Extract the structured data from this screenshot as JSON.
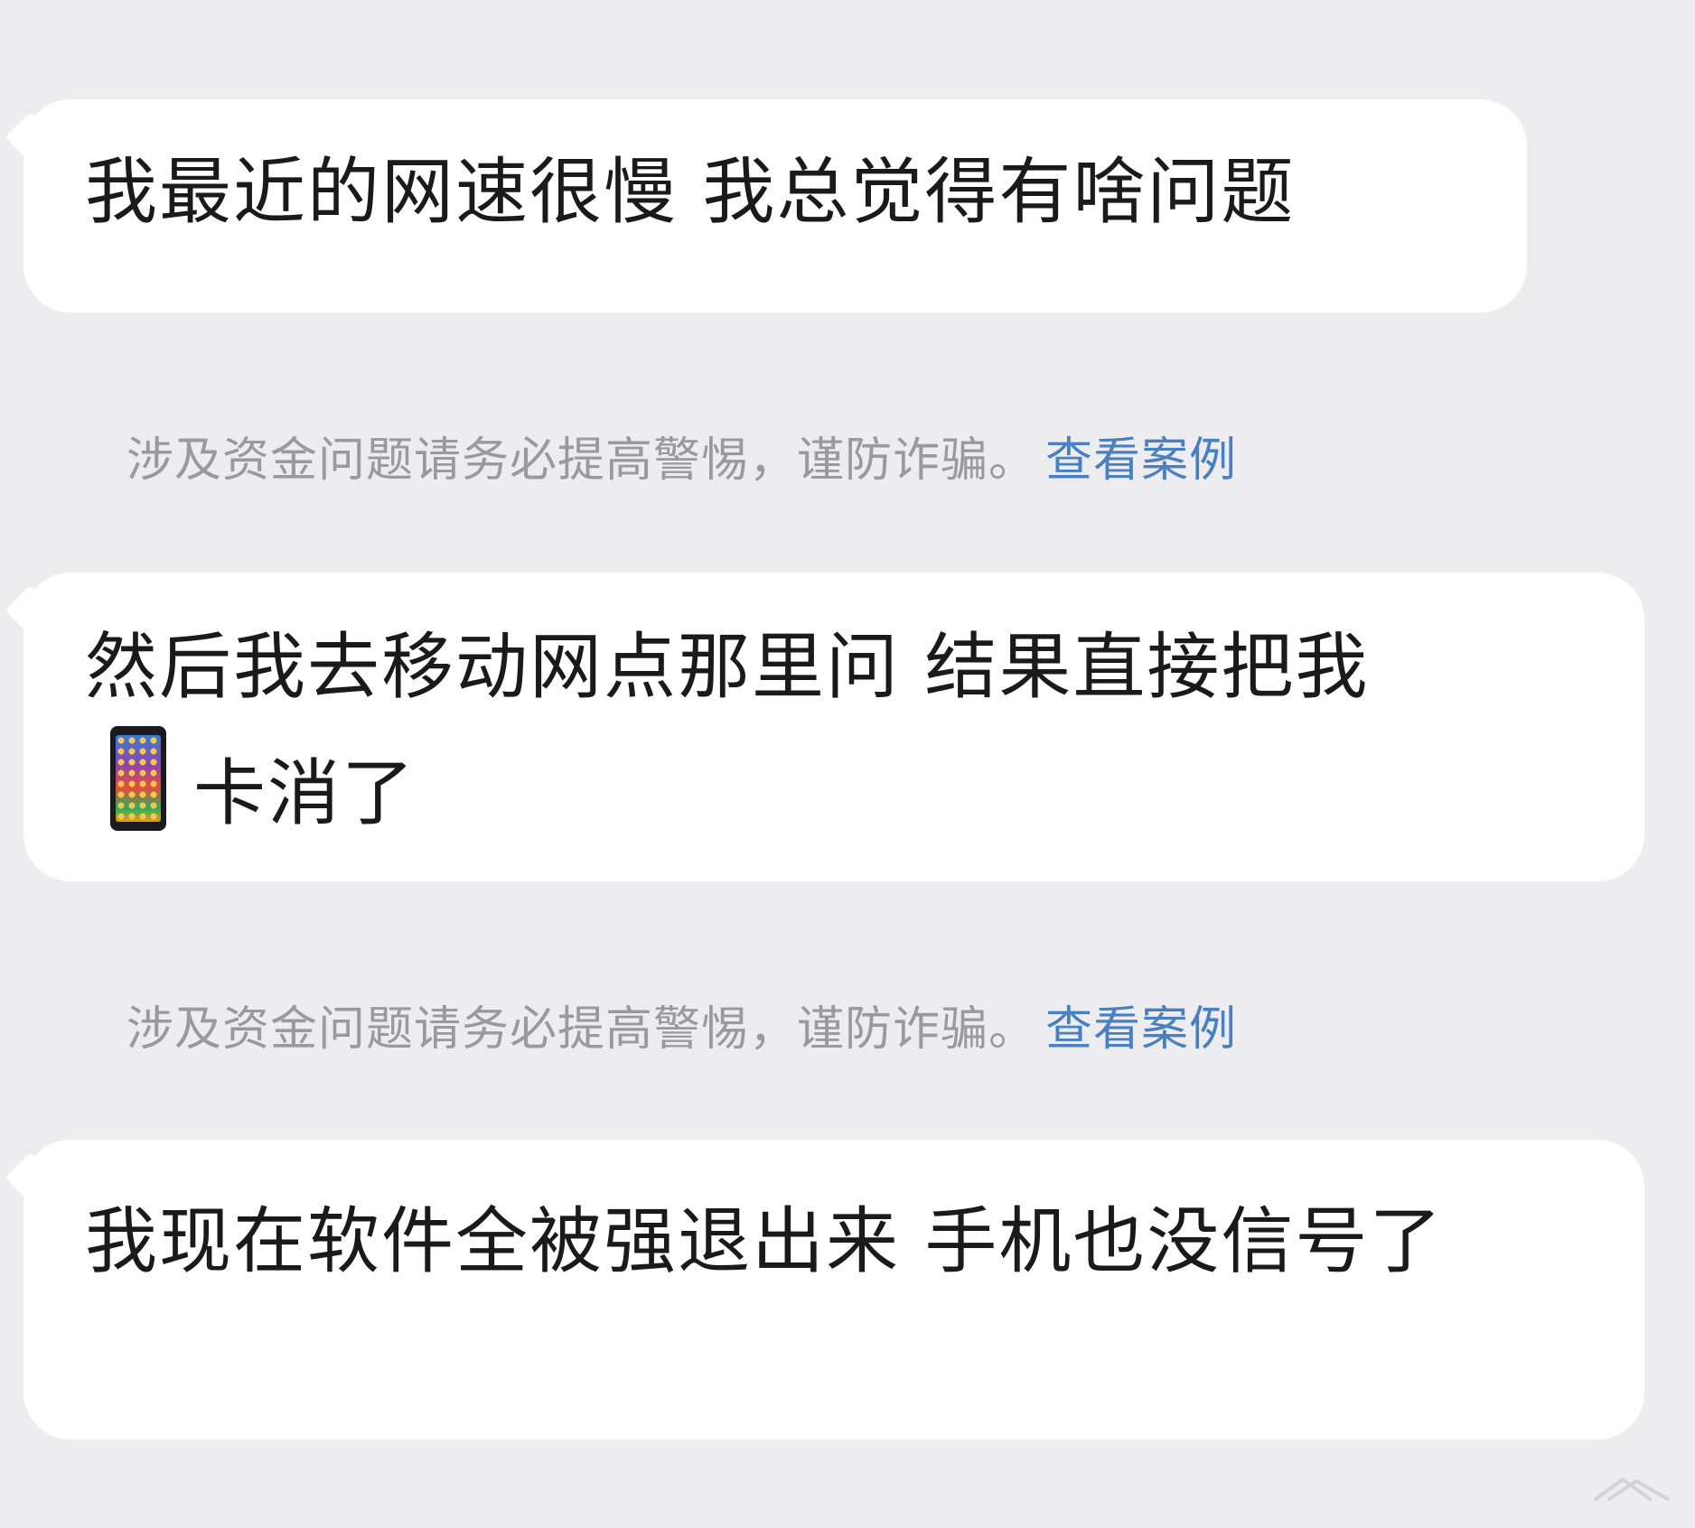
{
  "messages": [
    {
      "text": "我最近的网速很慢 我总觉得有啥问题"
    },
    {
      "text_before_icon": "然后我去移动网点那里问 结果直接把我",
      "icon": "mobile-phone-emoji-icon",
      "text_after_icon": "卡消了"
    },
    {
      "text": "我现在软件全被强退出来 手机也没信号了"
    }
  ],
  "notices": [
    {
      "text": "涉及资金问题请务必提高警惕，谨防诈骗。",
      "link": "查看案例"
    },
    {
      "text": "涉及资金问题请务必提高警惕，谨防诈骗。",
      "link": "查看案例"
    }
  ],
  "colors": {
    "background": "#ededef",
    "bubble": "#ffffff",
    "message_text": "#1a1a1a",
    "notice_text": "#9a9a9e",
    "notice_link": "#4a7fc1"
  }
}
